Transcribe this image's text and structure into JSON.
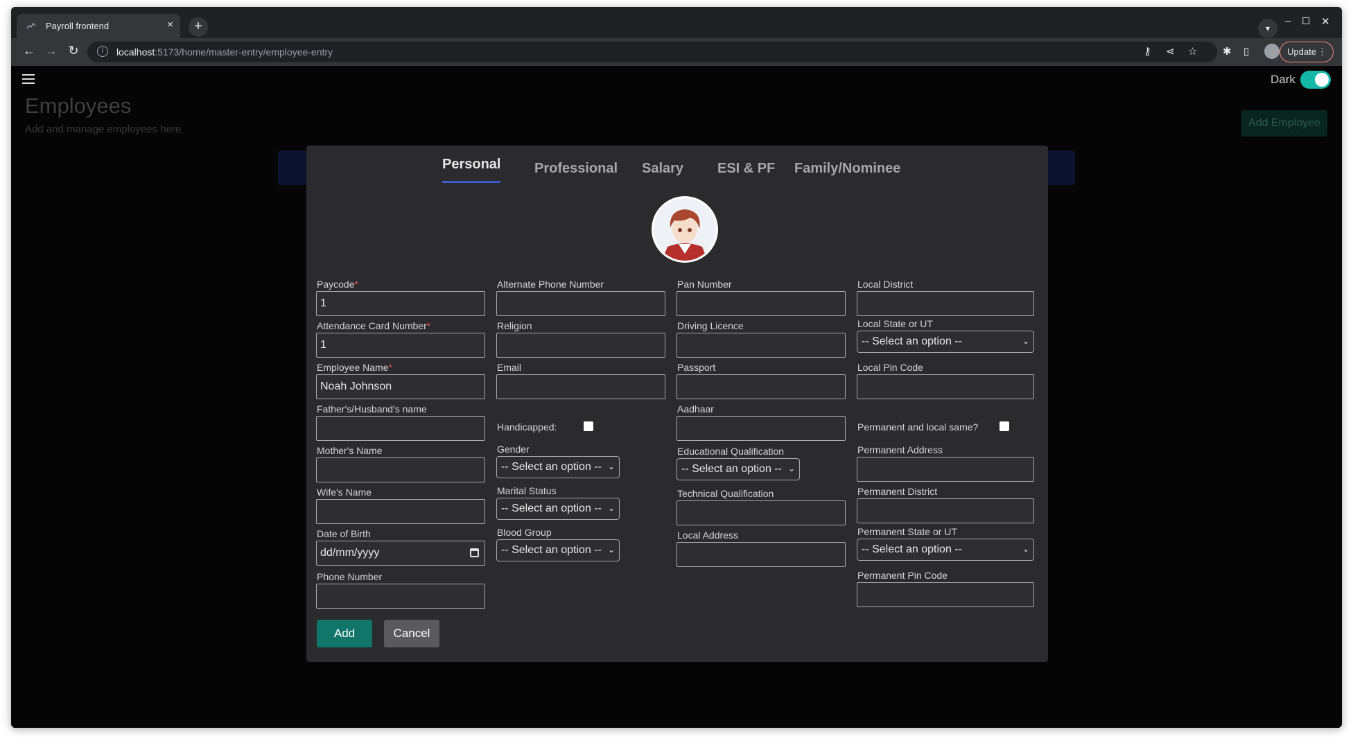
{
  "browser": {
    "tab_title": "Payroll frontend",
    "tab_close": "×",
    "new_tab": "+",
    "url_host": "localhost",
    "url_path": ":5173/home/master-entry/employee-entry",
    "update_label": "Update"
  },
  "header": {
    "dark_label": "Dark",
    "dark_mode_on": true,
    "title": "Employees",
    "subtitle": "Add and manage employees here",
    "add_button": "Add Employee"
  },
  "modal": {
    "tabs": [
      "Personal",
      "Professional",
      "Salary",
      "ESI & PF",
      "Family/Nominee"
    ],
    "active_tab": "Personal",
    "col1": {
      "paycode_label": "Paycode",
      "paycode_value": "1",
      "attendance_label": "Attendance Card Number",
      "attendance_value": "1",
      "name_label": "Employee Name",
      "name_value": "Noah Johnson",
      "father_label": "Father's/Husband's name",
      "mother_label": "Mother's Name",
      "wife_label": "Wife's Name",
      "dob_label": "Date of Birth",
      "dob_value": "dd/mm/yyyy",
      "phone_label": "Phone Number",
      "required_mark": "*"
    },
    "col2": {
      "alt_phone_label": "Alternate Phone Number",
      "religion_label": "Religion",
      "email_label": "Email",
      "handicapped_label": "Handicapped:",
      "gender_label": "Gender",
      "marital_label": "Marital Status",
      "blood_label": "Blood Group",
      "select_placeholder": "-- Select an option --"
    },
    "col3": {
      "pan_label": "Pan Number",
      "licence_label": "Driving Licence",
      "passport_label": "Passport",
      "aadhaar_label": "Aadhaar",
      "edu_label": "Educational Qualification",
      "tech_label": "Technical Qualification",
      "local_address_label": "Local Address"
    },
    "col4": {
      "local_district_label": "Local District",
      "local_state_label": "Local State or UT",
      "local_pin_label": "Local Pin Code",
      "same_label": "Permanent and local same?",
      "perm_address_label": "Permanent Address",
      "perm_district_label": "Permanent District",
      "perm_state_label": "Permanent State or UT",
      "perm_pin_label": "Permanent Pin Code"
    },
    "add_button": "Add",
    "cancel_button": "Cancel"
  }
}
